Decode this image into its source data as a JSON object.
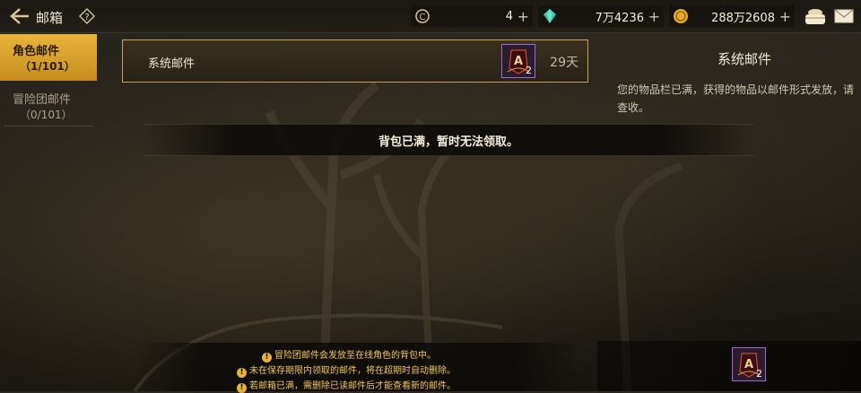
{
  "header": {
    "title": "邮箱",
    "help_icon": "question-diamond-icon",
    "currencies": [
      {
        "icon": "c-coin-icon",
        "value": "4"
      },
      {
        "icon": "green-gem-icon",
        "value": "7万4236"
      },
      {
        "icon": "gold-coin-icon",
        "value": "288万2608"
      }
    ],
    "plus_symbol": "+",
    "right_icons": [
      "bag-icon",
      "mail-icon"
    ]
  },
  "tabs": [
    {
      "label": "角色邮件",
      "count": "（1/101）",
      "active": true
    },
    {
      "label": "冒险团邮件",
      "count": "（0/101）",
      "active": false
    }
  ],
  "mail_list": [
    {
      "subject": "系统邮件",
      "days_left": "29天",
      "attachment": {
        "icon": "rune-card-icon",
        "count": "2"
      }
    }
  ],
  "banner": {
    "text": "背包已满，暂时无法领取。"
  },
  "detail": {
    "title": "系统邮件",
    "body": "您的物品栏已满，获得的物品以邮件形式发放，请查收。",
    "attachment": {
      "icon": "rune-card-icon",
      "count": "2"
    }
  },
  "notices": [
    "冒险团邮件会发放至在线角色的背包中。",
    "未在保存期限内领取的邮件，将在超期时自动删除。",
    "若邮箱已满，需删除已读邮件后才能查看新的邮件。"
  ],
  "colors": {
    "accent_gold": "#e9b53a",
    "selected_border": "#c9a44c",
    "notice_text": "#f0c660",
    "item_border": "#9c6bd0"
  }
}
